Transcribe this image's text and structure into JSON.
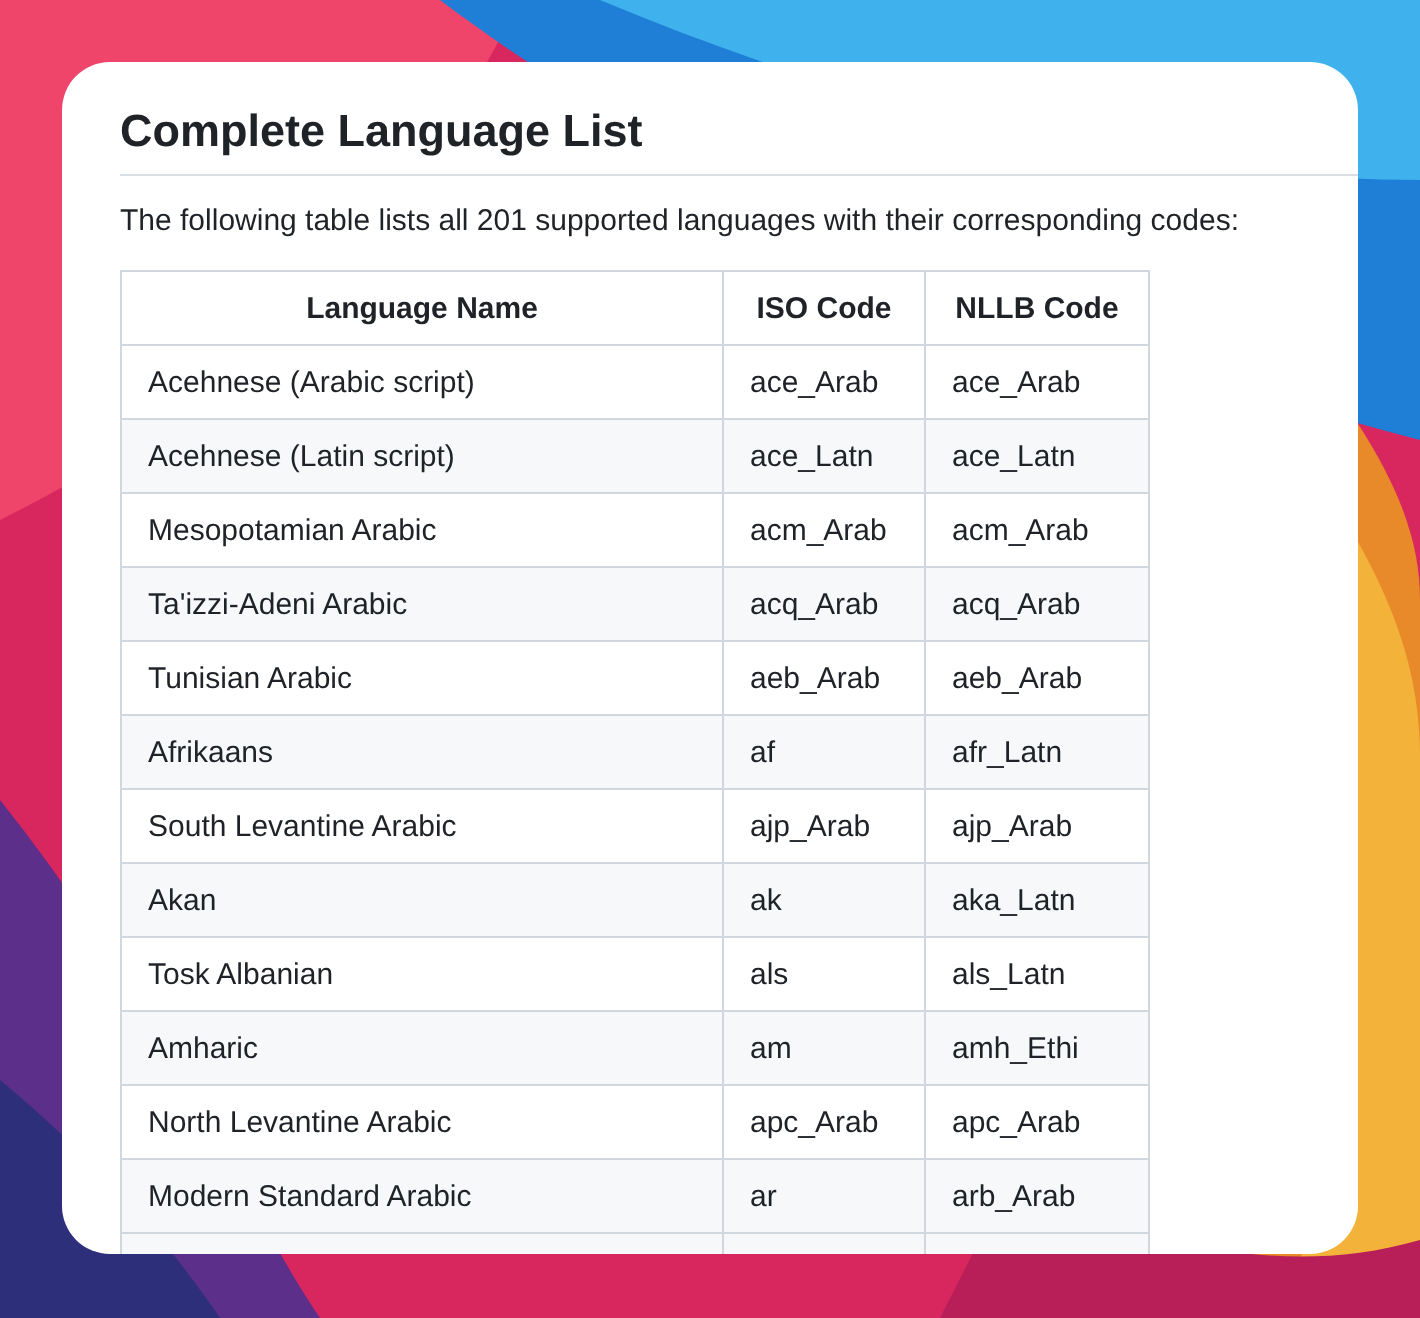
{
  "heading": "Complete Language List",
  "intro": "The following table lists all 201 supported languages with their corresponding codes:",
  "table": {
    "columns": [
      "Language Name",
      "ISO Code",
      "NLLB Code"
    ],
    "rows": [
      [
        "Acehnese (Arabic script)",
        "ace_Arab",
        "ace_Arab"
      ],
      [
        "Acehnese (Latin script)",
        "ace_Latn",
        "ace_Latn"
      ],
      [
        "Mesopotamian Arabic",
        "acm_Arab",
        "acm_Arab"
      ],
      [
        "Ta'izzi-Adeni Arabic",
        "acq_Arab",
        "acq_Arab"
      ],
      [
        "Tunisian Arabic",
        "aeb_Arab",
        "aeb_Arab"
      ],
      [
        "Afrikaans",
        "af",
        "afr_Latn"
      ],
      [
        "South Levantine Arabic",
        "ajp_Arab",
        "ajp_Arab"
      ],
      [
        "Akan",
        "ak",
        "aka_Latn"
      ],
      [
        "Tosk Albanian",
        "als",
        "als_Latn"
      ],
      [
        "Amharic",
        "am",
        "amh_Ethi"
      ],
      [
        "North Levantine Arabic",
        "apc_Arab",
        "apc_Arab"
      ],
      [
        "Modern Standard Arabic",
        "ar",
        "arb_Arab"
      ]
    ]
  }
}
